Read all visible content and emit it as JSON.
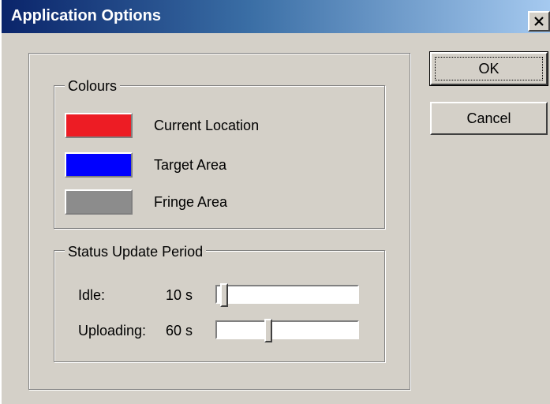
{
  "window": {
    "title": "Application Options",
    "close_icon": "close-icon"
  },
  "buttons": {
    "ok_label": "OK",
    "cancel_label": "Cancel"
  },
  "colours": {
    "group_label": "Colours",
    "items": [
      {
        "label": "Current Location",
        "color": "#ed1c24"
      },
      {
        "label": "Target Area",
        "color": "#0000ff"
      },
      {
        "label": "Fringe Area",
        "color": "#8c8c8c"
      }
    ]
  },
  "status": {
    "group_label": "Status Update Period",
    "rows": [
      {
        "label": "Idle:",
        "value": "10 s",
        "slider_fraction": 0.0
      },
      {
        "label": "Uploading:",
        "value": "60 s",
        "slider_fraction": 0.35
      }
    ]
  }
}
